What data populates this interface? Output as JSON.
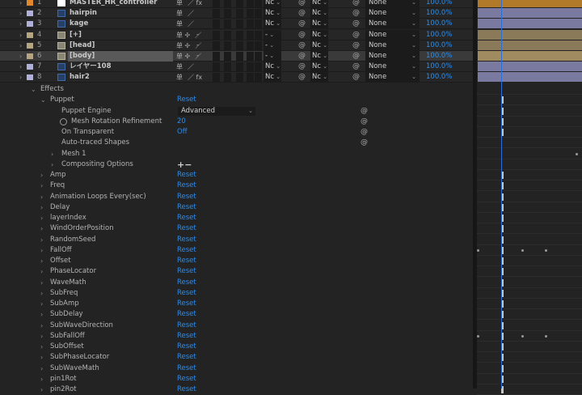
{
  "colors": {
    "bg": "#232323",
    "accent_blue": "#2d8ceb",
    "playhead": "#2a6fd8",
    "bar_orange": "#b07a2a",
    "bar_purple": "#7a7aa0",
    "bar_tan": "#8a7a5a"
  },
  "layers": [
    {
      "num": "1",
      "name": "MASTER_HR_controller",
      "label_color": "#e0892c",
      "type": "solid",
      "switch": "单",
      "extra": "／ fx",
      "has_dashes": false,
      "mode": "Nc",
      "mode2": "Nc",
      "parent": "None",
      "stretch": "100.0%",
      "bar_color": "#b07a2a"
    },
    {
      "num": "2",
      "name": "hairpin",
      "label_color": "#b0b0d8",
      "type": "pin",
      "switch": "单",
      "extra": "／",
      "has_dashes": false,
      "mode": "Nc",
      "mode2": "Nc",
      "parent": "None",
      "stretch": "100.0%",
      "bar_color": "#7a7aa0"
    },
    {
      "num": "3",
      "name": "kage",
      "label_color": "#b0b0d8",
      "type": "pin",
      "switch": "单",
      "extra": "／",
      "has_dashes": false,
      "mode": "Nc",
      "mode2": "Nc",
      "parent": "None",
      "stretch": "100.0%",
      "bar_color": "#7a7aa0"
    },
    {
      "num": "4",
      "name": "[+]",
      "label_color": "#b5a582",
      "type": "img",
      "switch": "单 ✢",
      "extra": "／",
      "has_dashes": true,
      "mode": "-",
      "mode2": "Nc",
      "parent": "None",
      "stretch": "100.0%",
      "bar_color": "#8a7a5a"
    },
    {
      "num": "5",
      "name": "[head]",
      "label_color": "#b5a582",
      "type": "img",
      "switch": "单 ✢",
      "extra": "／",
      "has_dashes": true,
      "mode": "-",
      "mode2": "Nc",
      "parent": "None",
      "stretch": "100.0%",
      "bar_color": "#8a7a5a"
    },
    {
      "num": "6",
      "name": "[body]",
      "label_color": "#b5a582",
      "type": "img",
      "switch": "单 ✢",
      "extra": "／",
      "has_dashes": true,
      "mode": "-",
      "mode2": "Nc",
      "parent": "None",
      "stretch": "100.0%",
      "bar_color": "#a08a60",
      "selected": true
    },
    {
      "num": "7",
      "name": "レイヤー108",
      "label_color": "#b0b0d8",
      "type": "pin",
      "switch": "单",
      "extra": "／",
      "has_dashes": false,
      "mode": "Nc",
      "mode2": "Nc",
      "parent": "None",
      "stretch": "100.0%",
      "bar_color": "#7a7aa0"
    },
    {
      "num": "8",
      "name": "hair2",
      "label_color": "#b0b0d8",
      "type": "pin",
      "switch": "单",
      "extra": "／ fx",
      "has_dashes": false,
      "mode": "Nc",
      "mode2": "Nc",
      "parent": "None",
      "stretch": "100.0%",
      "bar_color": "#7a7aa0"
    }
  ],
  "properties": [
    {
      "name": "Effects",
      "twirl": "⌄",
      "level": 0
    },
    {
      "name": "Puppet",
      "twirl": "⌄",
      "level": 1,
      "value": "Reset"
    },
    {
      "name": "Puppet Engine",
      "twirl": "",
      "level": 2,
      "dropdown": "Advanced",
      "spiral": true
    },
    {
      "name": "Mesh Rotation Refinement",
      "twirl": "",
      "level": 2,
      "value": "20",
      "spiral": true,
      "stopwatch": true
    },
    {
      "name": "On Transparent",
      "twirl": "",
      "level": 2,
      "value": "Off",
      "spiral": true
    },
    {
      "name": "Auto-traced Shapes",
      "twirl": "",
      "level": 2,
      "spiral": true
    },
    {
      "name": "Mesh 1",
      "twirl": "›",
      "level": 2
    },
    {
      "name": "Compositing Options",
      "twirl": "›",
      "level": 2,
      "pm": "+−"
    },
    {
      "name": "Amp",
      "twirl": "›",
      "level": 1,
      "value": "Reset"
    },
    {
      "name": "Freq",
      "twirl": "›",
      "level": 1,
      "value": "Reset"
    },
    {
      "name": "Animation Loops Every(sec)",
      "twirl": "›",
      "level": 1,
      "value": "Reset"
    },
    {
      "name": "Delay",
      "twirl": "›",
      "level": 1,
      "value": "Reset"
    },
    {
      "name": "layerIndex",
      "twirl": "›",
      "level": 1,
      "value": "Reset"
    },
    {
      "name": "WindOrderPosition",
      "twirl": "›",
      "level": 1,
      "value": "Reset"
    },
    {
      "name": "RandomSeed",
      "twirl": "›",
      "level": 1,
      "value": "Reset"
    },
    {
      "name": "FallOff",
      "twirl": "›",
      "level": 1,
      "value": "Reset"
    },
    {
      "name": "Offset",
      "twirl": "›",
      "level": 1,
      "value": "Reset"
    },
    {
      "name": "PhaseLocator",
      "twirl": "›",
      "level": 1,
      "value": "Reset"
    },
    {
      "name": "WaveMath",
      "twirl": "›",
      "level": 1,
      "value": "Reset"
    },
    {
      "name": "SubFreq",
      "twirl": "›",
      "level": 1,
      "value": "Reset"
    },
    {
      "name": "SubAmp",
      "twirl": "›",
      "level": 1,
      "value": "Reset"
    },
    {
      "name": "SubDelay",
      "twirl": "›",
      "level": 1,
      "value": "Reset"
    },
    {
      "name": "SubWaveDirection",
      "twirl": "›",
      "level": 1,
      "value": "Reset"
    },
    {
      "name": "SubFallOff",
      "twirl": "›",
      "level": 1,
      "value": "Reset"
    },
    {
      "name": "SubOffset",
      "twirl": "›",
      "level": 1,
      "value": "Reset"
    },
    {
      "name": "SubPhaseLocator",
      "twirl": "›",
      "level": 1,
      "value": "Reset"
    },
    {
      "name": "SubWaveMath",
      "twirl": "›",
      "level": 1,
      "value": "Reset"
    },
    {
      "name": "pin1Rot",
      "twirl": "›",
      "level": 1,
      "value": "Reset"
    },
    {
      "name": "pin2Rot",
      "twirl": "›",
      "level": 1,
      "value": "Reset"
    }
  ]
}
